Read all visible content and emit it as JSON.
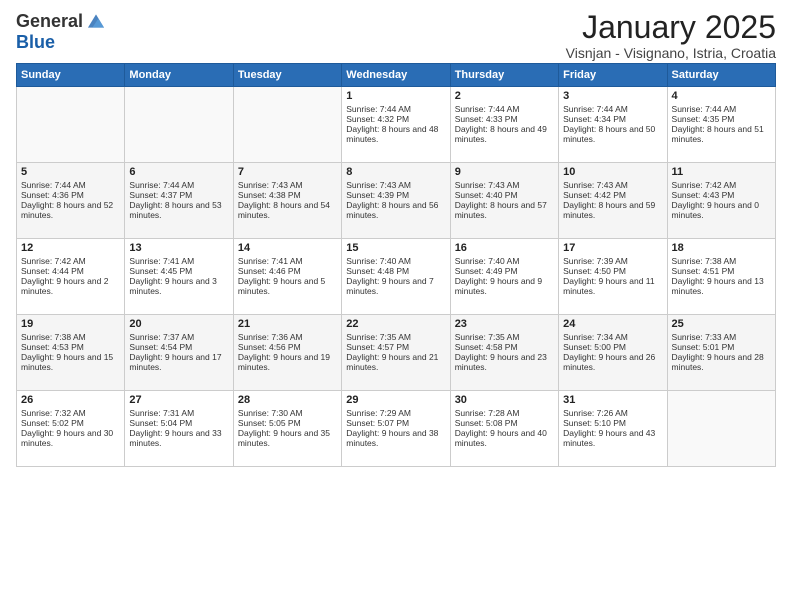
{
  "header": {
    "logo_general": "General",
    "logo_blue": "Blue",
    "month": "January 2025",
    "location": "Visnjan - Visignano, Istria, Croatia"
  },
  "weekdays": [
    "Sunday",
    "Monday",
    "Tuesday",
    "Wednesday",
    "Thursday",
    "Friday",
    "Saturday"
  ],
  "weeks": [
    [
      {
        "day": "",
        "info": ""
      },
      {
        "day": "",
        "info": ""
      },
      {
        "day": "",
        "info": ""
      },
      {
        "day": "1",
        "info": "Sunrise: 7:44 AM\nSunset: 4:32 PM\nDaylight: 8 hours and 48 minutes."
      },
      {
        "day": "2",
        "info": "Sunrise: 7:44 AM\nSunset: 4:33 PM\nDaylight: 8 hours and 49 minutes."
      },
      {
        "day": "3",
        "info": "Sunrise: 7:44 AM\nSunset: 4:34 PM\nDaylight: 8 hours and 50 minutes."
      },
      {
        "day": "4",
        "info": "Sunrise: 7:44 AM\nSunset: 4:35 PM\nDaylight: 8 hours and 51 minutes."
      }
    ],
    [
      {
        "day": "5",
        "info": "Sunrise: 7:44 AM\nSunset: 4:36 PM\nDaylight: 8 hours and 52 minutes."
      },
      {
        "day": "6",
        "info": "Sunrise: 7:44 AM\nSunset: 4:37 PM\nDaylight: 8 hours and 53 minutes."
      },
      {
        "day": "7",
        "info": "Sunrise: 7:43 AM\nSunset: 4:38 PM\nDaylight: 8 hours and 54 minutes."
      },
      {
        "day": "8",
        "info": "Sunrise: 7:43 AM\nSunset: 4:39 PM\nDaylight: 8 hours and 56 minutes."
      },
      {
        "day": "9",
        "info": "Sunrise: 7:43 AM\nSunset: 4:40 PM\nDaylight: 8 hours and 57 minutes."
      },
      {
        "day": "10",
        "info": "Sunrise: 7:43 AM\nSunset: 4:42 PM\nDaylight: 8 hours and 59 minutes."
      },
      {
        "day": "11",
        "info": "Sunrise: 7:42 AM\nSunset: 4:43 PM\nDaylight: 9 hours and 0 minutes."
      }
    ],
    [
      {
        "day": "12",
        "info": "Sunrise: 7:42 AM\nSunset: 4:44 PM\nDaylight: 9 hours and 2 minutes."
      },
      {
        "day": "13",
        "info": "Sunrise: 7:41 AM\nSunset: 4:45 PM\nDaylight: 9 hours and 3 minutes."
      },
      {
        "day": "14",
        "info": "Sunrise: 7:41 AM\nSunset: 4:46 PM\nDaylight: 9 hours and 5 minutes."
      },
      {
        "day": "15",
        "info": "Sunrise: 7:40 AM\nSunset: 4:48 PM\nDaylight: 9 hours and 7 minutes."
      },
      {
        "day": "16",
        "info": "Sunrise: 7:40 AM\nSunset: 4:49 PM\nDaylight: 9 hours and 9 minutes."
      },
      {
        "day": "17",
        "info": "Sunrise: 7:39 AM\nSunset: 4:50 PM\nDaylight: 9 hours and 11 minutes."
      },
      {
        "day": "18",
        "info": "Sunrise: 7:38 AM\nSunset: 4:51 PM\nDaylight: 9 hours and 13 minutes."
      }
    ],
    [
      {
        "day": "19",
        "info": "Sunrise: 7:38 AM\nSunset: 4:53 PM\nDaylight: 9 hours and 15 minutes."
      },
      {
        "day": "20",
        "info": "Sunrise: 7:37 AM\nSunset: 4:54 PM\nDaylight: 9 hours and 17 minutes."
      },
      {
        "day": "21",
        "info": "Sunrise: 7:36 AM\nSunset: 4:56 PM\nDaylight: 9 hours and 19 minutes."
      },
      {
        "day": "22",
        "info": "Sunrise: 7:35 AM\nSunset: 4:57 PM\nDaylight: 9 hours and 21 minutes."
      },
      {
        "day": "23",
        "info": "Sunrise: 7:35 AM\nSunset: 4:58 PM\nDaylight: 9 hours and 23 minutes."
      },
      {
        "day": "24",
        "info": "Sunrise: 7:34 AM\nSunset: 5:00 PM\nDaylight: 9 hours and 26 minutes."
      },
      {
        "day": "25",
        "info": "Sunrise: 7:33 AM\nSunset: 5:01 PM\nDaylight: 9 hours and 28 minutes."
      }
    ],
    [
      {
        "day": "26",
        "info": "Sunrise: 7:32 AM\nSunset: 5:02 PM\nDaylight: 9 hours and 30 minutes."
      },
      {
        "day": "27",
        "info": "Sunrise: 7:31 AM\nSunset: 5:04 PM\nDaylight: 9 hours and 33 minutes."
      },
      {
        "day": "28",
        "info": "Sunrise: 7:30 AM\nSunset: 5:05 PM\nDaylight: 9 hours and 35 minutes."
      },
      {
        "day": "29",
        "info": "Sunrise: 7:29 AM\nSunset: 5:07 PM\nDaylight: 9 hours and 38 minutes."
      },
      {
        "day": "30",
        "info": "Sunrise: 7:28 AM\nSunset: 5:08 PM\nDaylight: 9 hours and 40 minutes."
      },
      {
        "day": "31",
        "info": "Sunrise: 7:26 AM\nSunset: 5:10 PM\nDaylight: 9 hours and 43 minutes."
      },
      {
        "day": "",
        "info": ""
      }
    ]
  ]
}
